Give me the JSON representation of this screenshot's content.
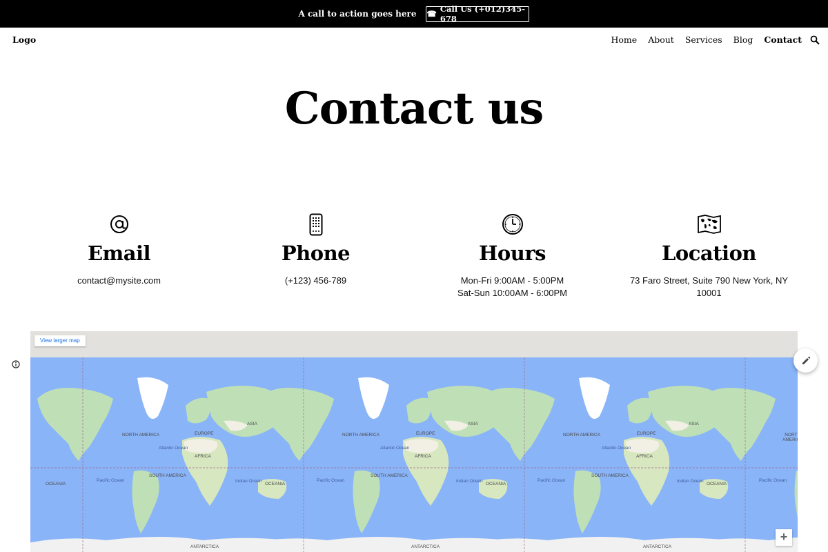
{
  "topbar": {
    "cta_text": "A call to action goes here",
    "call_button": "Call Us (+012)345-678",
    "phone_glyph": "☎"
  },
  "nav": {
    "logo": "Logo",
    "links": [
      "Home",
      "About",
      "Services",
      "Blog",
      "Contact"
    ],
    "active": "Contact",
    "search_icon": "search-icon"
  },
  "page": {
    "title": "Contact us"
  },
  "cards": [
    {
      "label": "Email",
      "value": "contact@mysite.com",
      "icon": "at-sign-icon"
    },
    {
      "label": "Phone",
      "value": "(+123) 456-789",
      "icon": "mobile-phone-icon"
    },
    {
      "label": "Hours",
      "value": "Mon-Fri 9:00AM - 5:00PM",
      "value2": "Sat-Sun 10:00AM - 6:00PM",
      "icon": "clock-icon"
    },
    {
      "label": "Location",
      "value": "73 Faro Street, Suite 790 New York, NY 10001",
      "icon": "world-map-icon"
    }
  ],
  "map": {
    "view_larger": "View larger map",
    "zoom_in": "+",
    "labels": {
      "north_america": "NORTH AMERICA",
      "south_america": "SOUTH AMERICA",
      "europe": "EUROPE",
      "asia": "ASIA",
      "africa": "AFRICA",
      "oceania": "OCEANIA",
      "antarctica": "ANTARCTICA",
      "atlantic": "Atlantic Ocean",
      "indian": "Indian Ocean",
      "pacific": "Pacific Ocean"
    },
    "colors": {
      "ocean": "#8ab4f8",
      "land": "#bfe0b6",
      "ice": "#ffffff",
      "desert": "#f2efe4"
    }
  }
}
